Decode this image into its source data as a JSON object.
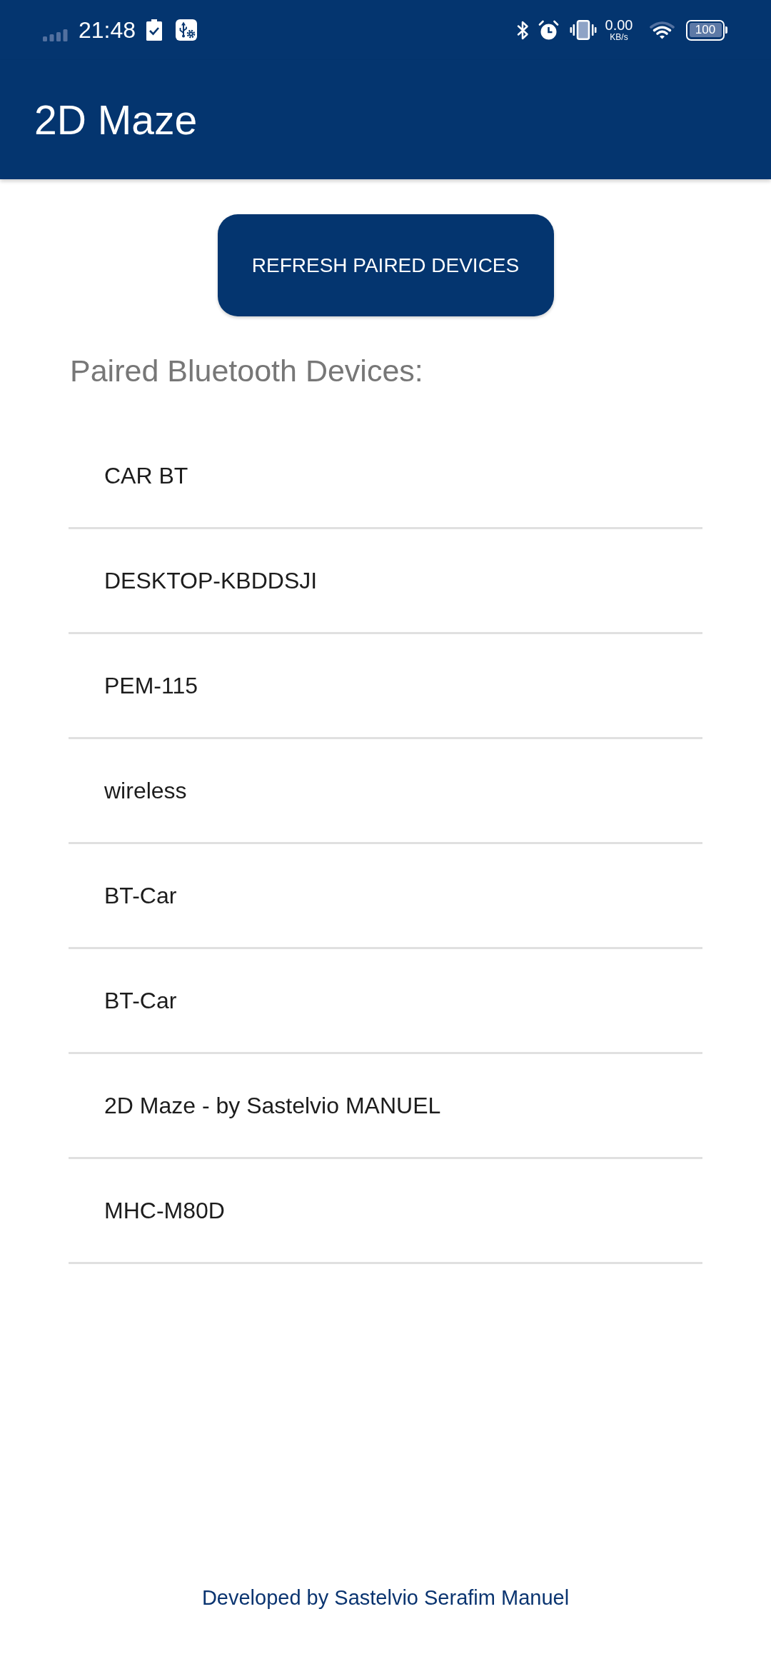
{
  "status_bar": {
    "time": "21:48",
    "network_speed": {
      "value": "0.00",
      "unit": "KB/s"
    },
    "battery": "100"
  },
  "app_bar": {
    "title": "2D Maze"
  },
  "refresh_button": {
    "label": "REFRESH PAIRED DEVICES"
  },
  "devices_heading": "Paired Bluetooth Devices:",
  "devices": [
    "CAR BT",
    "DESKTOP-KBDDSJI",
    "PEM-115",
    "wireless",
    "BT-Car",
    "BT-Car",
    "2D Maze - by Sastelvio MANUEL",
    "MHC-M80D"
  ],
  "footer": "Developed by Sastelvio Serafim Manuel"
}
